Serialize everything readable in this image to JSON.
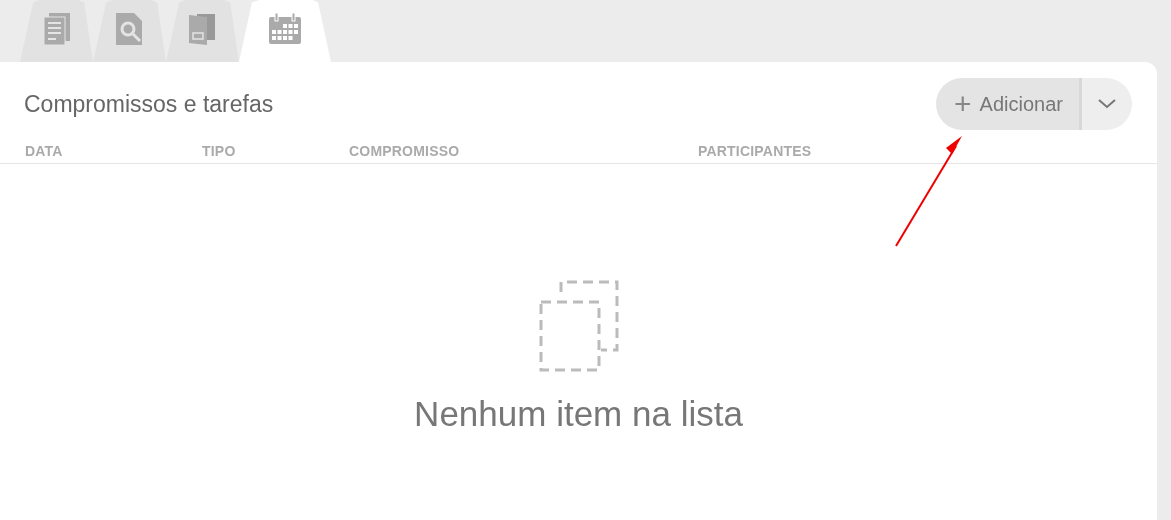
{
  "tabs": [
    {
      "kind": "documents",
      "selected": false
    },
    {
      "kind": "search",
      "selected": false
    },
    {
      "kind": "folder",
      "selected": false
    },
    {
      "kind": "calendar",
      "selected": true
    }
  ],
  "panel": {
    "title": "Compromissos e tarefas",
    "add_button": {
      "label": "Adicionar",
      "icon": "+"
    },
    "table": {
      "columns": [
        "DATA",
        "TIPO",
        "COMPROMISSO",
        "PARTICIPANTES"
      ]
    },
    "empty_message": "Nenhum item na lista"
  }
}
